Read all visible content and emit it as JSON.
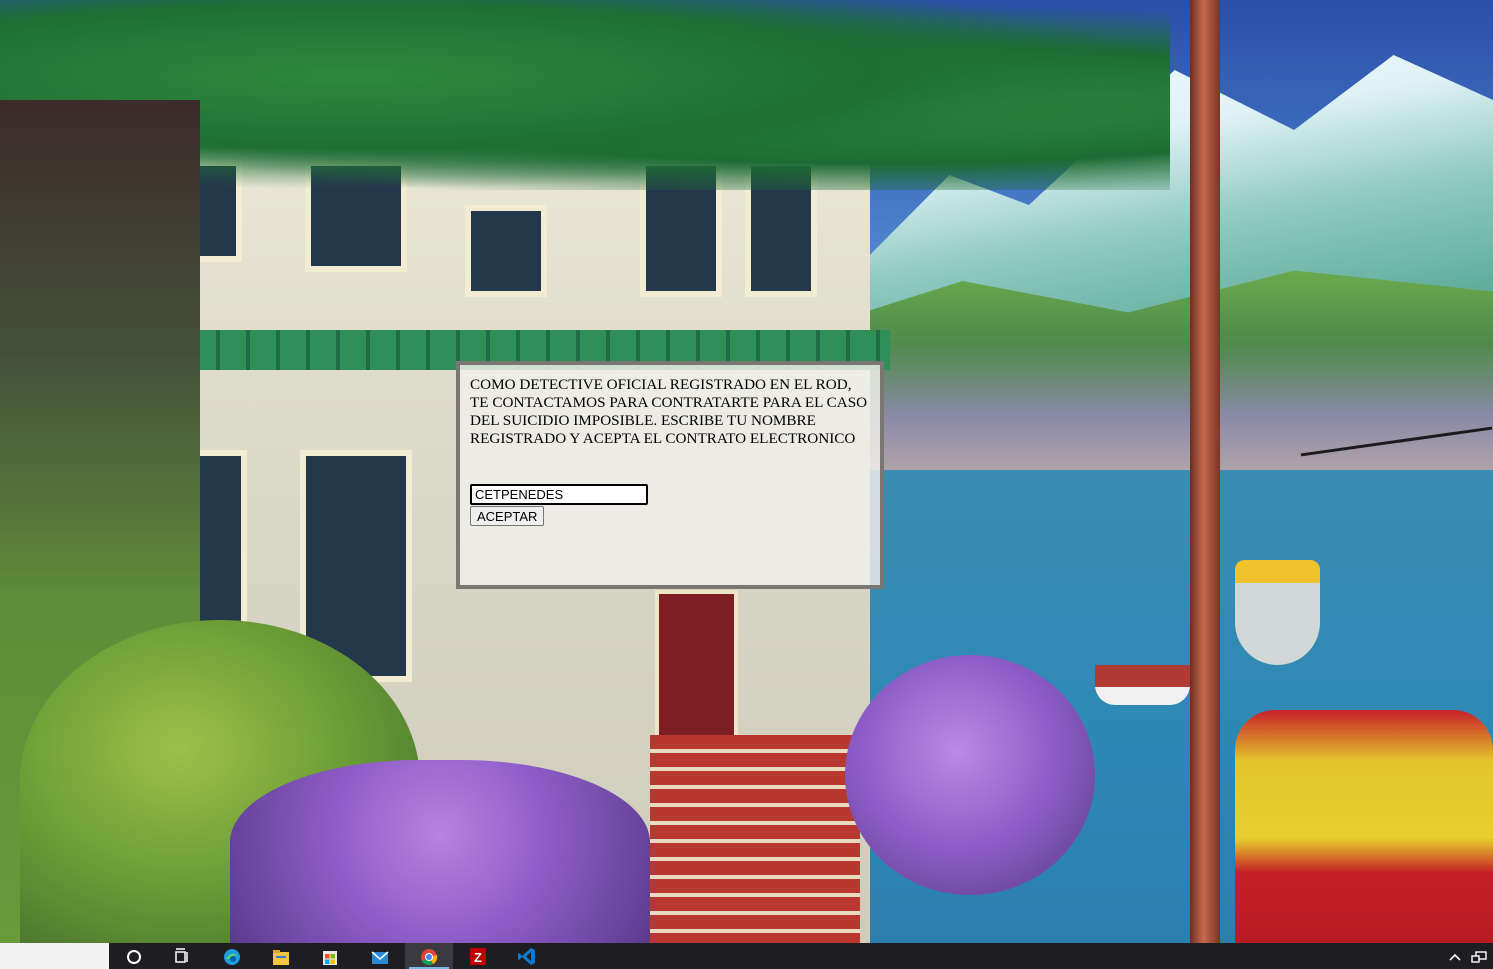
{
  "dialog": {
    "message": "COMO DETECTIVE OFICIAL REGISTRADO EN EL ROD, TE CONTACTAMOS PARA CONTRATARTE PARA EL CASO DEL SUICIDIO IMPOSIBLE. ESCRIBE TU NOMBRE REGISTRADO Y ACEPTA EL CONTRATO ELECTRONICO",
    "name_value": "CETPENEDES",
    "accept_label": "ACEPTAR"
  },
  "taskbar": {
    "search_box": "",
    "pinned": [
      {
        "icon": "cortana-circle-icon"
      },
      {
        "icon": "task-view-icon"
      },
      {
        "icon": "edge-icon"
      },
      {
        "icon": "file-explorer-icon"
      },
      {
        "icon": "microsoft-store-icon"
      },
      {
        "icon": "mail-icon"
      },
      {
        "icon": "chrome-icon",
        "active": true
      },
      {
        "icon": "filezilla-icon"
      },
      {
        "icon": "vscode-icon"
      }
    ],
    "tray": [
      {
        "icon": "chevron-up-icon"
      },
      {
        "icon": "network-icon"
      }
    ]
  },
  "colors": {
    "taskbar_bg": "#1e1e22",
    "dialog_border": "#7a7772",
    "active_indicator": "#76b9ed"
  }
}
